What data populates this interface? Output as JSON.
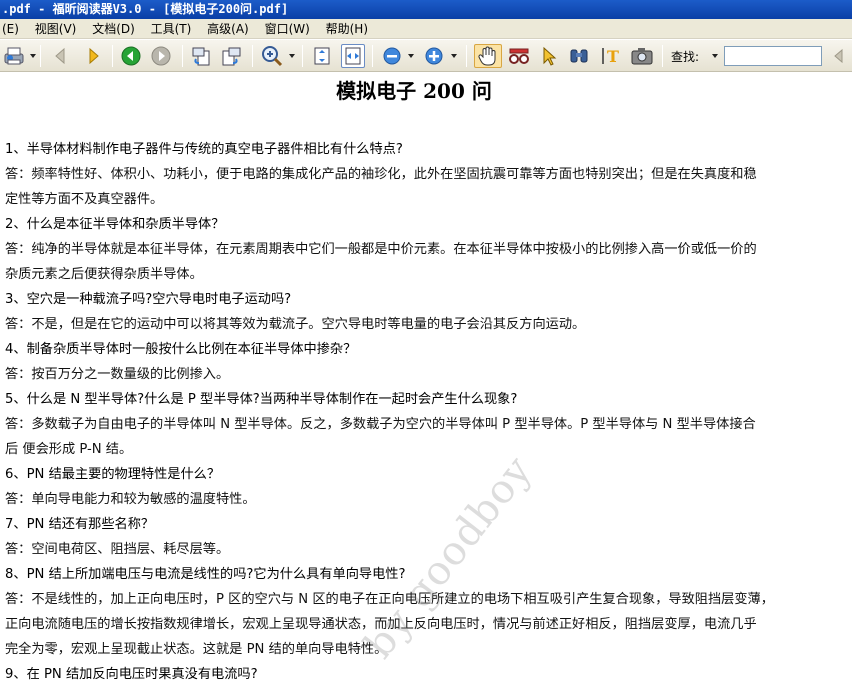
{
  "window": {
    "title": ".pdf - 福昕阅读器V3.0 - [模拟电子200问.pdf]"
  },
  "menu": [
    "(E)",
    "视图(V)",
    "文档(D)",
    "工具(T)",
    "高级(A)",
    "窗口(W)",
    "帮助(H)"
  ],
  "toolbar": {
    "icons": [
      "print-icon",
      "prev-page-icon",
      "next-page-icon",
      "back-icon",
      "forward-icon",
      "rotate-left-icon",
      "rotate-right-icon",
      "zoom-icon",
      "fit-page-icon",
      "fit-width-icon",
      "zoom-out-icon",
      "zoom-in-icon",
      "hand-tool-icon",
      "reading-glasses-icon",
      "select-arrow-icon",
      "binoculars-icon",
      "text-select-icon",
      "snapshot-icon"
    ],
    "find_label": "查找:",
    "find_value": ""
  },
  "document": {
    "title": "模拟电子 200 问",
    "lines": [
      "1、半导体材料制作电子器件与传统的真空电子器件相比有什么特点?",
      "答：频率特性好、体积小、功耗小，便于电路的集成化产品的袖珍化，此外在坚固抗震可靠等方面也特别突出；但是在失真度和稳",
      "定性等方面不及真空器件。",
      "2、什么是本征半导体和杂质半导体？",
      "答：纯净的半导体就是本征半导体，在元素周期表中它们一般都是中价元素。在本征半导体中按极小的比例掺入高一价或低一价的",
      "杂质元素之后便获得杂质半导体。",
      "3、空穴是一种载流子吗?空穴导电时电子运动吗?",
      "答：不是，但是在它的运动中可以将其等效为载流子。空穴导电时等电量的电子会沿其反方向运动。",
      "4、制备杂质半导体时一般按什么比例在本征半导体中掺杂？",
      "答：按百万分之一数量级的比例掺入。",
      "5、什么是 N 型半导体?什么是 P 型半导体?当两种半导体制作在一起时会产生什么现象?",
      "答：多数载子为自由电子的半导体叫 N 型半导体。反之，多数载子为空穴的半导体叫 P 型半导体。P 型半导体与 N 型半导体接合",
      "后  便会形成 P-N 结。",
      "6、PN 结最主要的物理特性是什么？",
      "答：单向导电能力和较为敏感的温度特性。",
      "7、PN 结还有那些名称？",
      "答：空间电荷区、阻挡层、耗尽层等。",
      "8、PN 结上所加端电压与电流是线性的吗?它为什么具有单向导电性?",
      "答：不是线性的，加上正向电压时，P 区的空穴与 N 区的电子在正向电压所建立的电场下相互吸引产生复合现象，导致阻挡层变薄，",
      "正向电流随电压的增长按指数规律增长，宏观上呈现导通状态，而加上反向电压时，情况与前述正好相反，阻挡层变厚，电流几乎",
      "完全为零，宏观上呈现截止状态。这就是 PN 结的单向导电特性。",
      "9、在 PN 结加反向电压时果真没有电流吗?"
    ],
    "watermark": "by  goodboy"
  }
}
